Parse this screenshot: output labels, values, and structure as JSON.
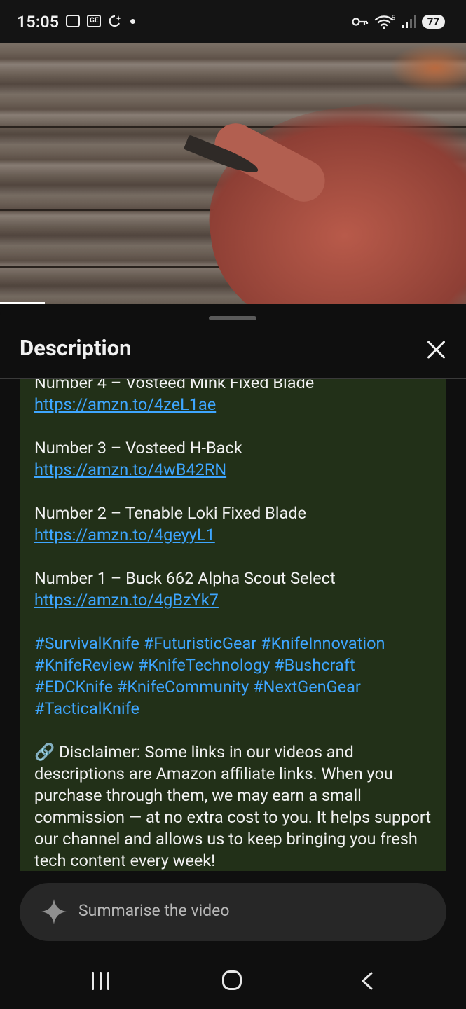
{
  "status_bar": {
    "time": "15:05",
    "battery": "77",
    "network": "5"
  },
  "sheet": {
    "title": "Description"
  },
  "description": {
    "items": [
      {
        "title": "Number 4 – Vosteed Mink Fixed Blade",
        "link": "https://amzn.to/4zeL1ae"
      },
      {
        "title": "Number 3 – Vosteed H-Back",
        "link": "https://amzn.to/4wB42RN"
      },
      {
        "title": "Number 2 – Tenable Loki Fixed Blade",
        "link": "https://amzn.to/4geyyL1"
      },
      {
        "title": "Number 1 – Buck 662 Alpha Scout Select",
        "link": "https://amzn.to/4gBzYk7"
      }
    ],
    "hashtags": [
      "#SurvivalKnife",
      "#FuturisticGear",
      "#KnifeInnovation",
      "#KnifeReview",
      "#KnifeTechnology",
      "#Bushcraft",
      "#EDCKnife",
      "#KnifeCommunity",
      "#NextGenGear",
      "#TacticalKnife"
    ],
    "disclaimer": "🔗 Disclaimer: Some links in our videos and descriptions are Amazon affiliate links. When you purchase through them, we may earn a small commission — at no extra cost to you. It helps support our channel and allows us to keep bringing you fresh tech content every week!"
  },
  "summarise": {
    "label": "Summarise the video",
    "icon": "sparkle-icon"
  },
  "nav": {
    "recent_icon": "recent-apps-icon",
    "home_icon": "home-icon",
    "back_icon": "back-icon"
  },
  "colors": {
    "link": "#3ea6ff",
    "content_bg": "#223018",
    "background": "#0f0f0f"
  },
  "video": {
    "progress_fraction": 0.096
  }
}
